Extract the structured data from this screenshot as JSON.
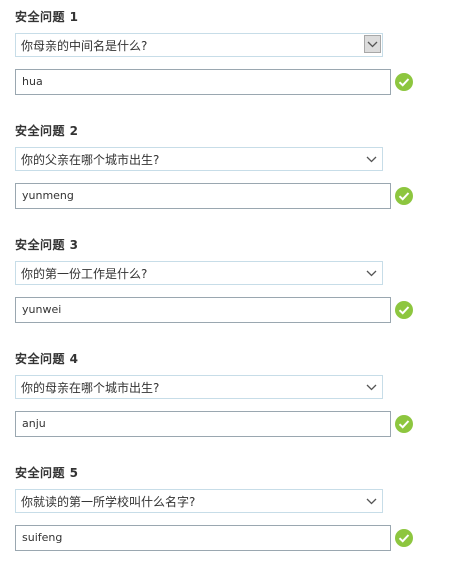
{
  "colors": {
    "check_green": "#8dc63f",
    "select_border": "#c7dde8",
    "input_border": "#9aa7b0",
    "label_text": "#333333"
  },
  "questions": [
    {
      "label": "安全问题 1",
      "question": "你母亲的中间名是什么?",
      "answer": "hua",
      "status_icon": "checkmark-icon"
    },
    {
      "label": "安全问题 2",
      "question": "你的父亲在哪个城市出生?",
      "answer": "yunmeng",
      "status_icon": "checkmark-icon"
    },
    {
      "label": "安全问题 3",
      "question": "你的第一份工作是什么?",
      "answer": "yunwei",
      "status_icon": "checkmark-icon"
    },
    {
      "label": "安全问题 4",
      "question": "你的母亲在哪个城市出生?",
      "answer": "anju",
      "status_icon": "checkmark-icon"
    },
    {
      "label": "安全问题 5",
      "question": "你就读的第一所学校叫什么名字?",
      "answer": "suifeng",
      "status_icon": "checkmark-icon"
    }
  ]
}
